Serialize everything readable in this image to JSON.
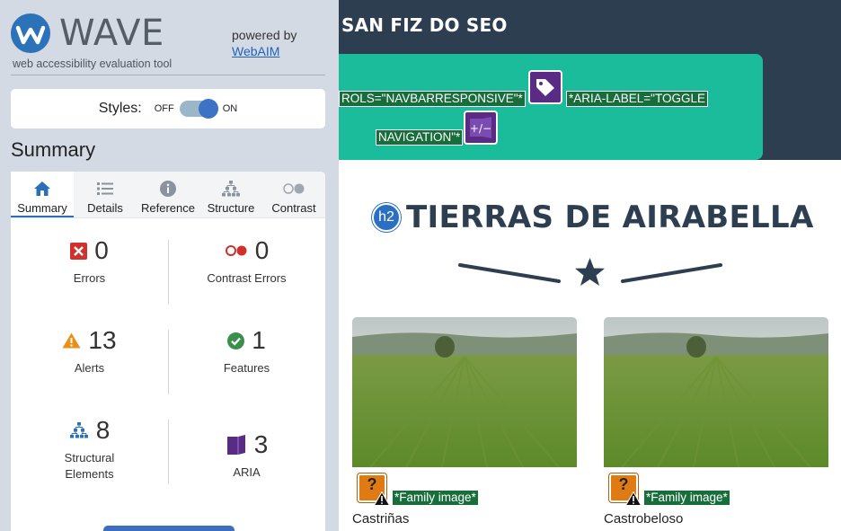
{
  "wave": {
    "logo_text": "WAVE",
    "tagline": "web accessibility evaluation tool",
    "powered_by": "powered by",
    "webaim_link": "WebAIM",
    "styles_label": "Styles:",
    "toggle_off": "OFF",
    "toggle_on": "ON",
    "summary_heading": "Summary",
    "tabs": [
      {
        "label": "Summary",
        "icon": "home-icon",
        "active": true
      },
      {
        "label": "Details",
        "icon": "list-icon"
      },
      {
        "label": "Reference",
        "icon": "info-icon"
      },
      {
        "label": "Structure",
        "icon": "sitemap-icon"
      },
      {
        "label": "Contrast",
        "icon": "contrast-icon"
      }
    ],
    "stats": {
      "errors": {
        "value": "0",
        "label": "Errors"
      },
      "contrast_errors": {
        "value": "0",
        "label": "Contrast Errors"
      },
      "alerts": {
        "value": "13",
        "label": "Alerts"
      },
      "features": {
        "value": "1",
        "label": "Features"
      },
      "structural": {
        "value": "8",
        "label_line1": "Structural",
        "label_line2": "Elements"
      },
      "aria": {
        "value": "3",
        "label": "ARIA"
      }
    },
    "colors": {
      "error": "#d0312d",
      "alert": "#e8901a",
      "feature": "#3b8f4a",
      "structure": "#2c72b9",
      "aria": "#5a2b85"
    }
  },
  "page": {
    "site_title": "SAN FIZ DO SEO",
    "aria_controls_label": "ROLS=\"NAVBARRESPONSIVE\"*",
    "aria_label_line1": "*ARIA-LABEL=\"TOGGLE",
    "aria_label_line2": "NAVIGATION\"*",
    "h2_badge": "h2",
    "section_title": "TIERRAS DE AIRABELLA",
    "cards": [
      {
        "alt_label": "*Family image*",
        "caption": "Castriñas"
      },
      {
        "alt_label": "*Family image*",
        "caption": "Castrobeloso"
      }
    ],
    "colors": {
      "header": "#2d3e50",
      "nav": "#1abc9c",
      "wave_label": "#176e3b"
    }
  }
}
